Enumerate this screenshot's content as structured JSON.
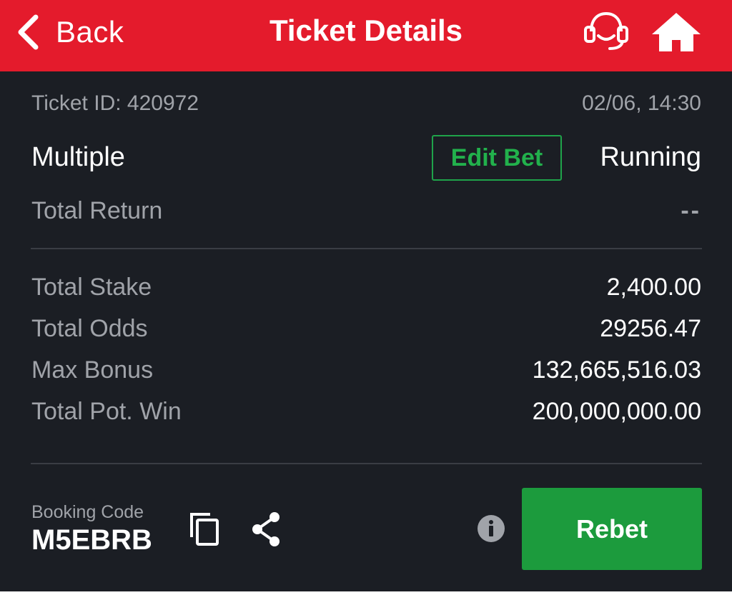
{
  "header": {
    "back_label": "Back",
    "title": "Ticket Details",
    "support_icon": "headset-icon",
    "home_icon": "home-icon",
    "bg_color": "#e41b2c"
  },
  "ticket": {
    "id_text": "Ticket ID: 420972",
    "datetime": "02/06, 14:30",
    "bet_type": "Multiple",
    "edit_bet_label": "Edit Bet",
    "status": "Running",
    "total_return_label": "Total Return",
    "total_return_value": "--"
  },
  "stats": [
    {
      "label": "Total Stake",
      "value": "2,400.00"
    },
    {
      "label": "Total Odds",
      "value": "29256.47"
    },
    {
      "label": "Max Bonus",
      "value": "132,665,516.03"
    },
    {
      "label": "Total Pot. Win",
      "value": "200,000,000.00"
    }
  ],
  "footer": {
    "booking_label": "Booking Code",
    "booking_code": "M5EBRB",
    "copy_icon": "copy-icon",
    "share_icon": "share-icon",
    "info_icon": "info-icon",
    "rebet_label": "Rebet",
    "accent_color": "#1c9b3d"
  }
}
